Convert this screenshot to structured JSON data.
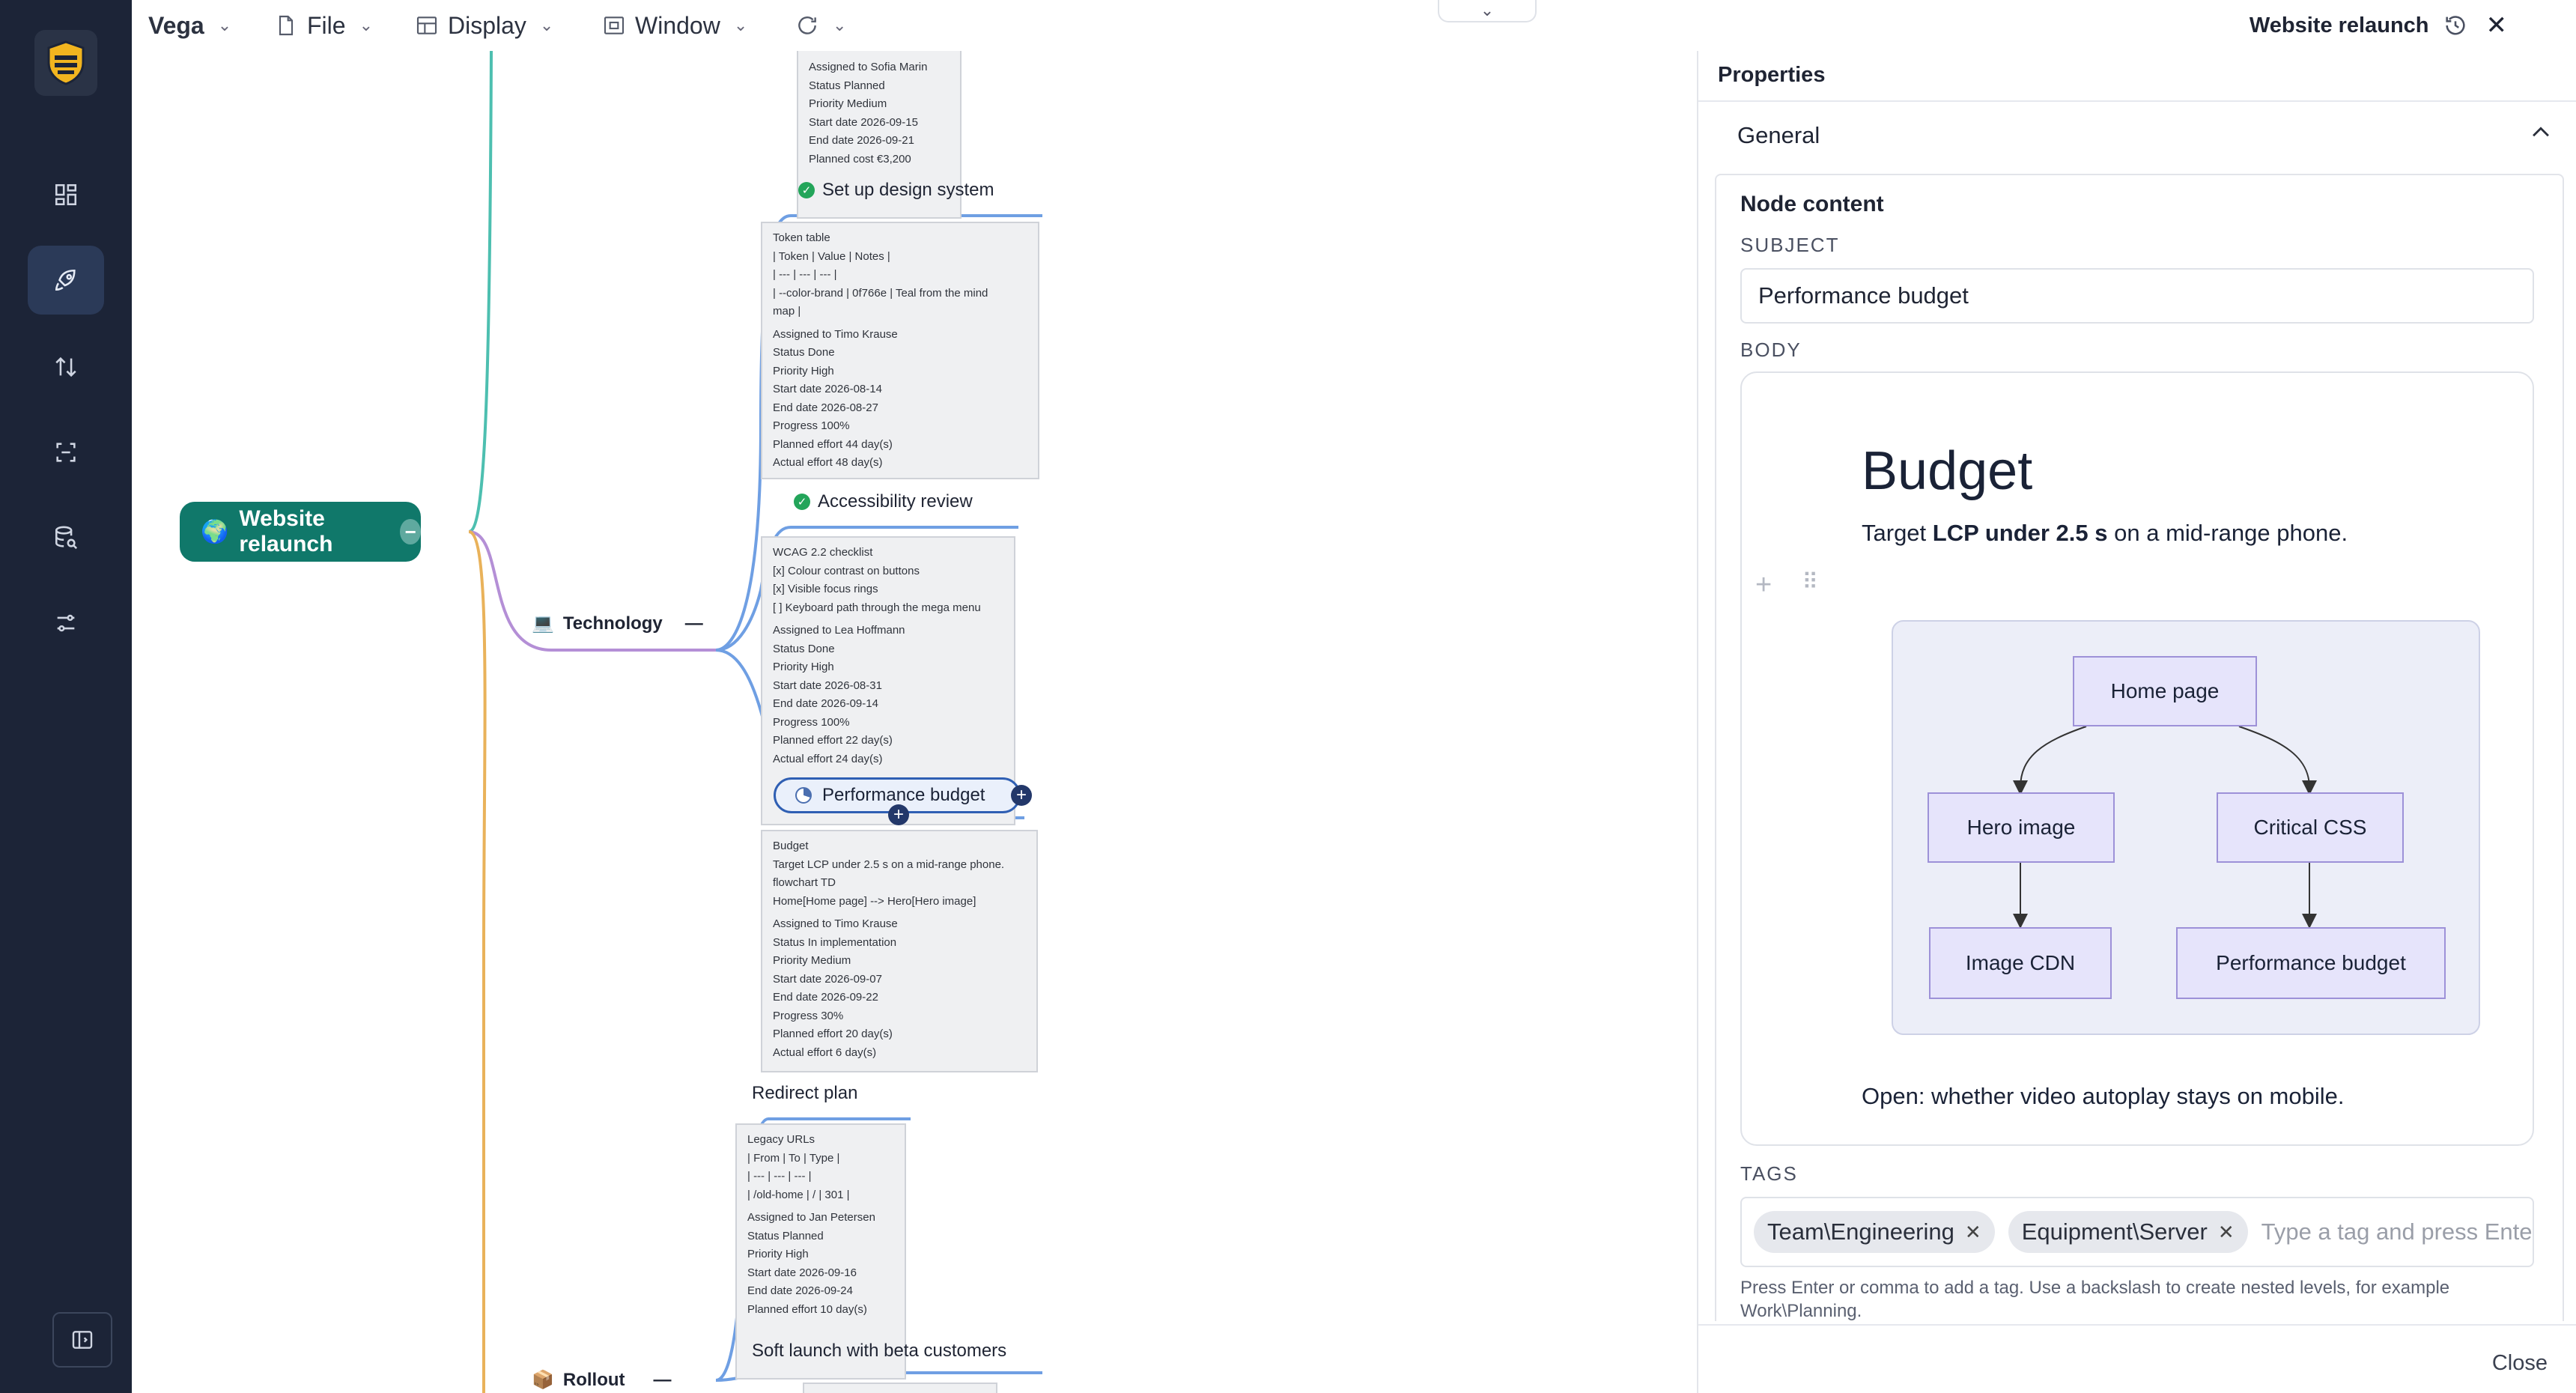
{
  "app": {
    "name": "Vega",
    "menus": [
      {
        "label": "File",
        "icon": "file-icon"
      },
      {
        "label": "Display",
        "icon": "grid-icon"
      },
      {
        "label": "Window",
        "icon": "window-icon"
      }
    ],
    "document_title": "Website relaunch"
  },
  "sidebar": {
    "items": [
      {
        "icon": "dashboard-icon"
      },
      {
        "icon": "rocket-icon",
        "active": true
      },
      {
        "icon": "sort-arrows-icon"
      },
      {
        "icon": "focus-frame-icon"
      },
      {
        "icon": "database-search-icon"
      },
      {
        "icon": "sliders-icon"
      }
    ],
    "footer_icon": "sidebar-toggle-icon"
  },
  "mindmap": {
    "root": "Website relaunch",
    "branches": [
      {
        "label": "Technology",
        "collapse": "—"
      },
      {
        "label": "Rollout",
        "collapse": "—"
      }
    ],
    "top_note": [
      "Assigned to   Sofia Marin",
      "Status   Planned",
      "Priority   Medium",
      "Start date   2026-09-15",
      "End date   2026-09-21",
      "Planned cost   €3,200"
    ],
    "tasks": [
      {
        "title": "Set up design system",
        "done": true,
        "note": [
          "Token table",
          "| Token | Value | Notes |",
          "| --- | --- | --- |",
          "| --color-brand | 0f766e | Teal from the mind",
          "map |",
          "",
          "Assigned to   Timo Krause",
          "Status   Done",
          "Priority   High",
          "Start date   2026-08-14",
          "End date   2026-08-27",
          "Progress   100%",
          "Planned effort   44 day(s)",
          "Actual effort   48 day(s)"
        ]
      },
      {
        "title": "Accessibility review",
        "done": true,
        "note": [
          "WCAG 2.2 checklist",
          "[x] Colour contrast on buttons",
          "[x] Visible focus rings",
          "[ ] Keyboard path through the mega menu",
          "",
          "Assigned to   Lea Hoffmann",
          "Status   Done",
          "Priority   High",
          "Start date   2026-08-31",
          "End date   2026-09-14",
          "Progress   100%",
          "Planned effort   22 day(s)",
          "Actual effort   24 day(s)"
        ]
      },
      {
        "title": "Performance budget",
        "selected": true,
        "progress": 0.3,
        "note": [
          "Budget",
          "Target LCP under 2.5 s on a mid-range phone.",
          "flowchart TD",
          "Home[Home page] --> Hero[Hero image]",
          "",
          "Assigned to   Timo Krause",
          "Status   In implementation",
          "Priority   Medium",
          "Start date   2026-09-07",
          "End date   2026-09-22",
          "Progress   30%",
          "Planned effort   20 day(s)",
          "Actual effort   6 day(s)"
        ]
      },
      {
        "title": "Redirect plan",
        "note": [
          "Legacy URLs",
          "| From | To | Type |",
          "| --- | --- | --- |",
          "| /old-home | / | 301 |",
          "",
          "Assigned to   Jan Petersen",
          "Status   Planned",
          "Priority   High",
          "Start date   2026-09-16",
          "End date   2026-09-24",
          "Planned effort   10 day(s)"
        ]
      },
      {
        "title": "Soft launch with beta customers"
      }
    ]
  },
  "properties": {
    "header": "Properties",
    "section": "General",
    "node_content_heading": "Node content",
    "subject_label": "SUBJECT",
    "subject_value": "Performance budget",
    "body_label": "BODY",
    "body": {
      "heading": "Budget",
      "text_pre": "Target ",
      "text_bold": "LCP under 2.5 s",
      "text_post": " on a mid-range phone.",
      "flowchart_nodes": [
        "Home page",
        "Hero image",
        "Critical CSS",
        "Image CDN",
        "Performance budget"
      ],
      "footer": "Open: whether video autoplay stays on mobile."
    },
    "tags_label": "TAGS",
    "tags": [
      "Team\\Engineering",
      "Equipment\\Server"
    ],
    "tag_placeholder": "Type a tag and press Enter",
    "tags_help": "Press Enter or comma to add a tag. Use a backslash to create nested levels, for example Work\\Planning.",
    "close_label": "Close"
  },
  "colors": {
    "rail": "#1c2437",
    "root_node": "#10786a",
    "branch_teal": "#4dbfb0",
    "branch_purple": "#b48fd6",
    "branch_orange": "#e9b25a",
    "link_blue": "#6f9fe3",
    "selection": "#2f5fb3"
  }
}
